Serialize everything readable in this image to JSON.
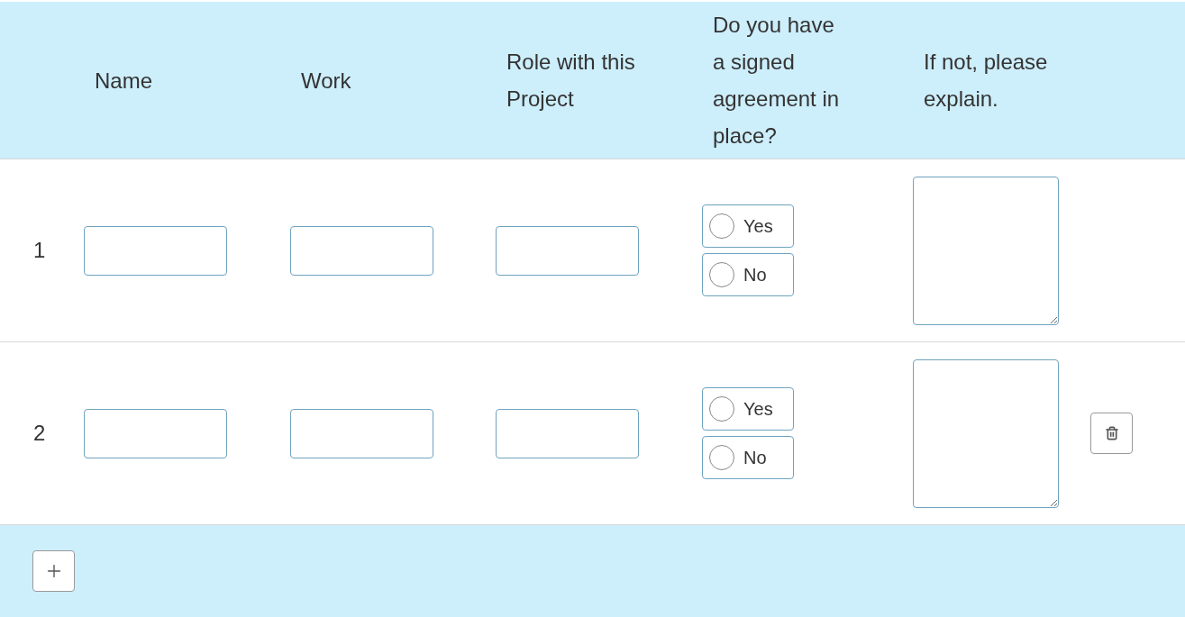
{
  "table": {
    "columns": [
      "Name",
      "Work",
      "Role with this Project",
      "Do you have a signed agreement in place?",
      "If not, please explain."
    ],
    "rows": [
      {
        "number": "1",
        "agreement": [
          {
            "label": "Yes",
            "selected": false
          },
          {
            "label": "No",
            "selected": false
          }
        ],
        "deletable": false
      },
      {
        "number": "2",
        "agreement": [
          {
            "label": "Yes",
            "selected": false
          },
          {
            "label": "No",
            "selected": false
          }
        ],
        "deletable": true
      }
    ]
  }
}
